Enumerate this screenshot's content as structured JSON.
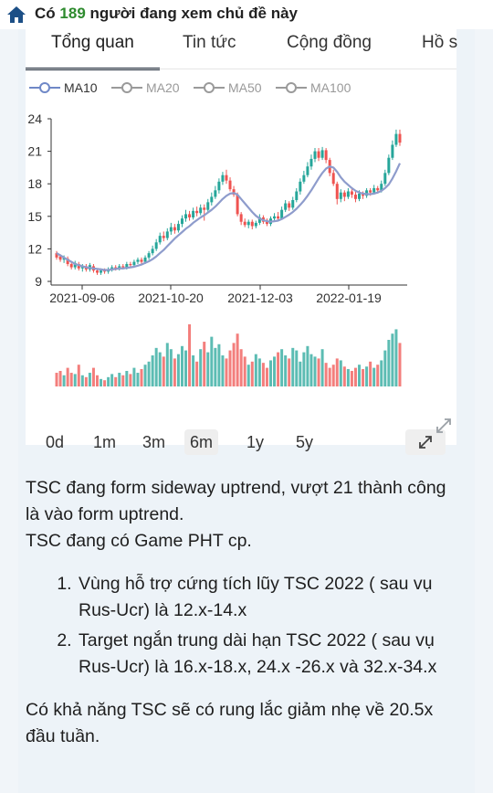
{
  "header": {
    "prefix": "Có",
    "count": "189",
    "suffix": "người đang xem chủ đề này"
  },
  "tabs": [
    {
      "label": "Tổng quan",
      "active": true
    },
    {
      "label": "Tin tức"
    },
    {
      "label": "Cộng đồng"
    },
    {
      "label": "Hồ s"
    }
  ],
  "legend": [
    {
      "label": "MA10",
      "active": true
    },
    {
      "label": "MA20"
    },
    {
      "label": "MA50"
    },
    {
      "label": "MA100"
    }
  ],
  "colors": {
    "up": "#26a69a",
    "down": "#ef5350",
    "ma": "#8e9ccc",
    "home": "#1c4f86",
    "count": "#2e8b2e"
  },
  "chart_data": {
    "type": "candlestick",
    "ylim": [
      9,
      24
    ],
    "yticks": [
      "9",
      "12",
      "15",
      "18",
      "21",
      "24"
    ],
    "xticks": [
      "2021-09-06",
      "2021-10-20",
      "2021-12-03",
      "2022-01-19"
    ],
    "candles": [
      {
        "o": 11.6,
        "c": 11.2,
        "h": 11.8,
        "l": 11.0
      },
      {
        "o": 11.3,
        "c": 11.0,
        "h": 11.5,
        "l": 10.8
      },
      {
        "o": 11.0,
        "c": 11.2,
        "h": 11.4,
        "l": 10.7
      },
      {
        "o": 11.1,
        "c": 10.6,
        "h": 11.3,
        "l": 10.4
      },
      {
        "o": 10.6,
        "c": 10.3,
        "h": 10.8,
        "l": 10.1
      },
      {
        "o": 10.3,
        "c": 10.7,
        "h": 10.9,
        "l": 10.1
      },
      {
        "o": 10.6,
        "c": 10.2,
        "h": 10.8,
        "l": 10.0
      },
      {
        "o": 10.2,
        "c": 10.4,
        "h": 10.6,
        "l": 9.9
      },
      {
        "o": 10.4,
        "c": 10.1,
        "h": 10.6,
        "l": 9.9
      },
      {
        "o": 10.1,
        "c": 10.5,
        "h": 10.7,
        "l": 9.9
      },
      {
        "o": 10.4,
        "c": 10.0,
        "h": 10.6,
        "l": 9.8
      },
      {
        "o": 10.0,
        "c": 9.8,
        "h": 10.2,
        "l": 9.6
      },
      {
        "o": 9.8,
        "c": 10.0,
        "h": 10.2,
        "l": 9.6
      },
      {
        "o": 10.0,
        "c": 9.9,
        "h": 10.2,
        "l": 9.7
      },
      {
        "o": 9.9,
        "c": 10.1,
        "h": 10.3,
        "l": 9.7
      },
      {
        "o": 10.1,
        "c": 10.3,
        "h": 10.5,
        "l": 9.9
      },
      {
        "o": 10.3,
        "c": 10.2,
        "h": 10.5,
        "l": 10.0
      },
      {
        "o": 10.2,
        "c": 10.4,
        "h": 10.6,
        "l": 10.0
      },
      {
        "o": 10.4,
        "c": 10.3,
        "h": 10.6,
        "l": 10.1
      },
      {
        "o": 10.3,
        "c": 10.6,
        "h": 10.8,
        "l": 10.1
      },
      {
        "o": 10.6,
        "c": 10.5,
        "h": 10.8,
        "l": 10.3
      },
      {
        "o": 10.5,
        "c": 10.8,
        "h": 11.0,
        "l": 10.3
      },
      {
        "o": 10.8,
        "c": 11.0,
        "h": 11.2,
        "l": 10.6
      },
      {
        "o": 11.0,
        "c": 10.8,
        "h": 11.2,
        "l": 10.6
      },
      {
        "o": 10.8,
        "c": 11.2,
        "h": 11.4,
        "l": 10.6
      },
      {
        "o": 11.2,
        "c": 11.6,
        "h": 11.8,
        "l": 11.0
      },
      {
        "o": 11.6,
        "c": 12.0,
        "h": 12.3,
        "l": 11.4
      },
      {
        "o": 12.0,
        "c": 12.6,
        "h": 12.9,
        "l": 11.8
      },
      {
        "o": 12.6,
        "c": 13.2,
        "h": 13.5,
        "l": 12.4
      },
      {
        "o": 13.2,
        "c": 13.0,
        "h": 13.6,
        "l": 12.7
      },
      {
        "o": 13.0,
        "c": 13.6,
        "h": 13.9,
        "l": 12.8
      },
      {
        "o": 13.6,
        "c": 14.0,
        "h": 14.4,
        "l": 13.3
      },
      {
        "o": 14.0,
        "c": 13.7,
        "h": 14.3,
        "l": 13.4
      },
      {
        "o": 13.7,
        "c": 14.3,
        "h": 14.6,
        "l": 13.5
      },
      {
        "o": 14.3,
        "c": 14.8,
        "h": 15.1,
        "l": 14.0
      },
      {
        "o": 14.8,
        "c": 15.2,
        "h": 15.6,
        "l": 14.5
      },
      {
        "o": 15.2,
        "c": 14.9,
        "h": 15.5,
        "l": 14.6
      },
      {
        "o": 14.9,
        "c": 15.5,
        "h": 15.8,
        "l": 14.7
      },
      {
        "o": 15.5,
        "c": 15.3,
        "h": 15.9,
        "l": 15.0
      },
      {
        "o": 15.3,
        "c": 15.8,
        "h": 16.1,
        "l": 15.1
      },
      {
        "o": 15.8,
        "c": 15.6,
        "h": 16.1,
        "l": 14.6
      },
      {
        "o": 15.6,
        "c": 16.3,
        "h": 16.6,
        "l": 15.4
      },
      {
        "o": 16.3,
        "c": 16.8,
        "h": 17.2,
        "l": 16.0
      },
      {
        "o": 16.8,
        "c": 17.4,
        "h": 17.8,
        "l": 16.6
      },
      {
        "o": 17.4,
        "c": 18.2,
        "h": 18.5,
        "l": 17.1
      },
      {
        "o": 18.2,
        "c": 18.8,
        "h": 19.1,
        "l": 17.9
      },
      {
        "o": 18.8,
        "c": 18.3,
        "h": 19.3,
        "l": 18.0
      },
      {
        "o": 18.3,
        "c": 17.5,
        "h": 18.6,
        "l": 17.3
      },
      {
        "o": 17.5,
        "c": 17.0,
        "h": 17.8,
        "l": 16.8
      },
      {
        "o": 17.0,
        "c": 15.2,
        "h": 17.2,
        "l": 15.0
      },
      {
        "o": 15.2,
        "c": 14.5,
        "h": 15.4,
        "l": 14.2
      },
      {
        "o": 14.5,
        "c": 14.2,
        "h": 14.8,
        "l": 14.0
      },
      {
        "o": 14.2,
        "c": 14.5,
        "h": 14.7,
        "l": 13.9
      },
      {
        "o": 14.5,
        "c": 14.1,
        "h": 14.7,
        "l": 13.8
      },
      {
        "o": 14.1,
        "c": 14.4,
        "h": 14.6,
        "l": 13.9
      },
      {
        "o": 14.4,
        "c": 14.9,
        "h": 15.2,
        "l": 14.2
      },
      {
        "o": 14.9,
        "c": 14.5,
        "h": 15.1,
        "l": 14.3
      },
      {
        "o": 14.5,
        "c": 14.3,
        "h": 14.8,
        "l": 14.1
      },
      {
        "o": 14.3,
        "c": 14.8,
        "h": 15.0,
        "l": 14.1
      },
      {
        "o": 14.8,
        "c": 15.0,
        "h": 15.3,
        "l": 14.6
      },
      {
        "o": 15.0,
        "c": 14.8,
        "h": 15.4,
        "l": 14.6
      },
      {
        "o": 14.8,
        "c": 15.6,
        "h": 15.9,
        "l": 14.7
      },
      {
        "o": 15.6,
        "c": 16.2,
        "h": 16.5,
        "l": 15.4
      },
      {
        "o": 16.2,
        "c": 15.8,
        "h": 16.4,
        "l": 15.5
      },
      {
        "o": 15.8,
        "c": 16.5,
        "h": 16.8,
        "l": 15.6
      },
      {
        "o": 16.5,
        "c": 17.3,
        "h": 17.6,
        "l": 16.3
      },
      {
        "o": 17.3,
        "c": 18.2,
        "h": 18.5,
        "l": 17.0
      },
      {
        "o": 18.2,
        "c": 18.8,
        "h": 19.2,
        "l": 18.0
      },
      {
        "o": 18.8,
        "c": 19.6,
        "h": 20.0,
        "l": 18.6
      },
      {
        "o": 19.6,
        "c": 20.3,
        "h": 20.7,
        "l": 19.3
      },
      {
        "o": 20.3,
        "c": 21.0,
        "h": 21.3,
        "l": 20.0
      },
      {
        "o": 21.0,
        "c": 20.4,
        "h": 21.3,
        "l": 20.1
      },
      {
        "o": 20.4,
        "c": 21.1,
        "h": 21.4,
        "l": 20.2
      },
      {
        "o": 21.1,
        "c": 20.2,
        "h": 21.3,
        "l": 19.9
      },
      {
        "o": 20.2,
        "c": 19.0,
        "h": 20.4,
        "l": 18.7
      },
      {
        "o": 19.0,
        "c": 18.0,
        "h": 19.3,
        "l": 17.8
      },
      {
        "o": 18.0,
        "c": 16.6,
        "h": 18.2,
        "l": 16.1
      },
      {
        "o": 16.6,
        "c": 17.2,
        "h": 17.5,
        "l": 16.3
      },
      {
        "o": 17.2,
        "c": 16.8,
        "h": 17.4,
        "l": 16.4
      },
      {
        "o": 16.8,
        "c": 17.3,
        "h": 17.6,
        "l": 16.6
      },
      {
        "o": 17.3,
        "c": 17.0,
        "h": 17.5,
        "l": 16.7
      },
      {
        "o": 17.0,
        "c": 16.6,
        "h": 17.3,
        "l": 16.3
      },
      {
        "o": 16.6,
        "c": 17.1,
        "h": 17.4,
        "l": 16.4
      },
      {
        "o": 17.1,
        "c": 16.9,
        "h": 17.3,
        "l": 16.6
      },
      {
        "o": 16.9,
        "c": 17.4,
        "h": 17.6,
        "l": 16.7
      },
      {
        "o": 17.4,
        "c": 17.2,
        "h": 17.6,
        "l": 16.9
      },
      {
        "o": 17.2,
        "c": 17.6,
        "h": 17.9,
        "l": 17.0
      },
      {
        "o": 17.6,
        "c": 17.4,
        "h": 17.8,
        "l": 17.1
      },
      {
        "o": 17.4,
        "c": 18.0,
        "h": 18.3,
        "l": 17.2
      },
      {
        "o": 18.0,
        "c": 19.0,
        "h": 19.3,
        "l": 17.8
      },
      {
        "o": 19.0,
        "c": 20.4,
        "h": 20.7,
        "l": 18.8
      },
      {
        "o": 20.4,
        "c": 21.6,
        "h": 22.0,
        "l": 20.2
      },
      {
        "o": 21.6,
        "c": 22.6,
        "h": 23.0,
        "l": 21.4
      },
      {
        "o": 22.6,
        "c": 21.8,
        "h": 23.0,
        "l": 21.5
      }
    ],
    "ma10": [
      11.6,
      11.4,
      11.2,
      11.0,
      10.8,
      10.6,
      10.5,
      10.4,
      10.3,
      10.25,
      10.2,
      10.15,
      10.1,
      10.05,
      10.05,
      10.1,
      10.15,
      10.2,
      10.2,
      10.25,
      10.3,
      10.35,
      10.45,
      10.55,
      10.7,
      10.85,
      11.05,
      11.3,
      11.6,
      11.9,
      12.25,
      12.6,
      12.95,
      13.25,
      13.55,
      13.85,
      14.1,
      14.4,
      14.65,
      14.9,
      15.1,
      15.35,
      15.6,
      15.9,
      16.25,
      16.6,
      16.9,
      17.1,
      17.15,
      17.0,
      16.6,
      16.2,
      15.8,
      15.4,
      15.05,
      14.8,
      14.65,
      14.55,
      14.5,
      14.55,
      14.6,
      14.75,
      14.95,
      15.15,
      15.4,
      15.7,
      16.05,
      16.45,
      16.9,
      17.4,
      17.95,
      18.5,
      19.0,
      19.4,
      19.6,
      19.5,
      19.1,
      18.6,
      18.2,
      17.9,
      17.6,
      17.35,
      17.2,
      17.1,
      17.05,
      17.05,
      17.1,
      17.2,
      17.35,
      17.6,
      17.95,
      18.5,
      19.15,
      19.9
    ],
    "volumes": [
      0.22,
      0.25,
      0.18,
      0.3,
      0.22,
      0.2,
      0.35,
      0.18,
      0.15,
      0.22,
      0.3,
      0.18,
      0.12,
      0.1,
      0.15,
      0.2,
      0.15,
      0.22,
      0.18,
      0.25,
      0.2,
      0.3,
      0.22,
      0.28,
      0.35,
      0.4,
      0.5,
      0.62,
      0.55,
      0.48,
      0.7,
      0.6,
      0.45,
      0.52,
      0.65,
      0.58,
      1.0,
      0.5,
      0.4,
      0.6,
      0.72,
      0.55,
      0.8,
      0.62,
      0.68,
      0.5,
      0.45,
      0.58,
      0.7,
      0.85,
      0.6,
      0.48,
      0.35,
      0.4,
      0.52,
      0.45,
      0.38,
      0.3,
      0.42,
      0.48,
      0.55,
      0.6,
      0.5,
      0.45,
      0.62,
      0.58,
      0.4,
      0.55,
      0.65,
      0.52,
      0.48,
      0.45,
      0.6,
      0.38,
      0.3,
      0.35,
      0.45,
      0.42,
      0.32,
      0.28,
      0.25,
      0.3,
      0.35,
      0.28,
      0.32,
      0.4,
      0.3,
      0.35,
      0.42,
      0.58,
      0.75,
      0.85,
      0.92,
      0.7
    ]
  },
  "ranges": [
    {
      "label": "0d"
    },
    {
      "label": "1m"
    },
    {
      "label": "3m"
    },
    {
      "label": "6m",
      "active": true
    },
    {
      "label": "1y"
    },
    {
      "label": "5y"
    }
  ],
  "post": {
    "p1": "TSC đang form sideway uptrend, vượt 21 thành công là vào form uptrend.",
    "p2": "TSC đang có Game PHT cp.",
    "list": [
      "Vùng hỗ trợ cứng tích lũy TSC 2022 ( sau vụ Rus-Ucr) là 12.x-14.x",
      "Target ngắn trung dài hạn TSC 2022 ( sau vụ Rus-Ucr) là 16.x-18.x, 24.x -26.x và 32.x-34.x"
    ],
    "p3": "Có khả năng TSC sẽ có rung lắc giảm nhẹ về 20.5x đầu tuần."
  }
}
